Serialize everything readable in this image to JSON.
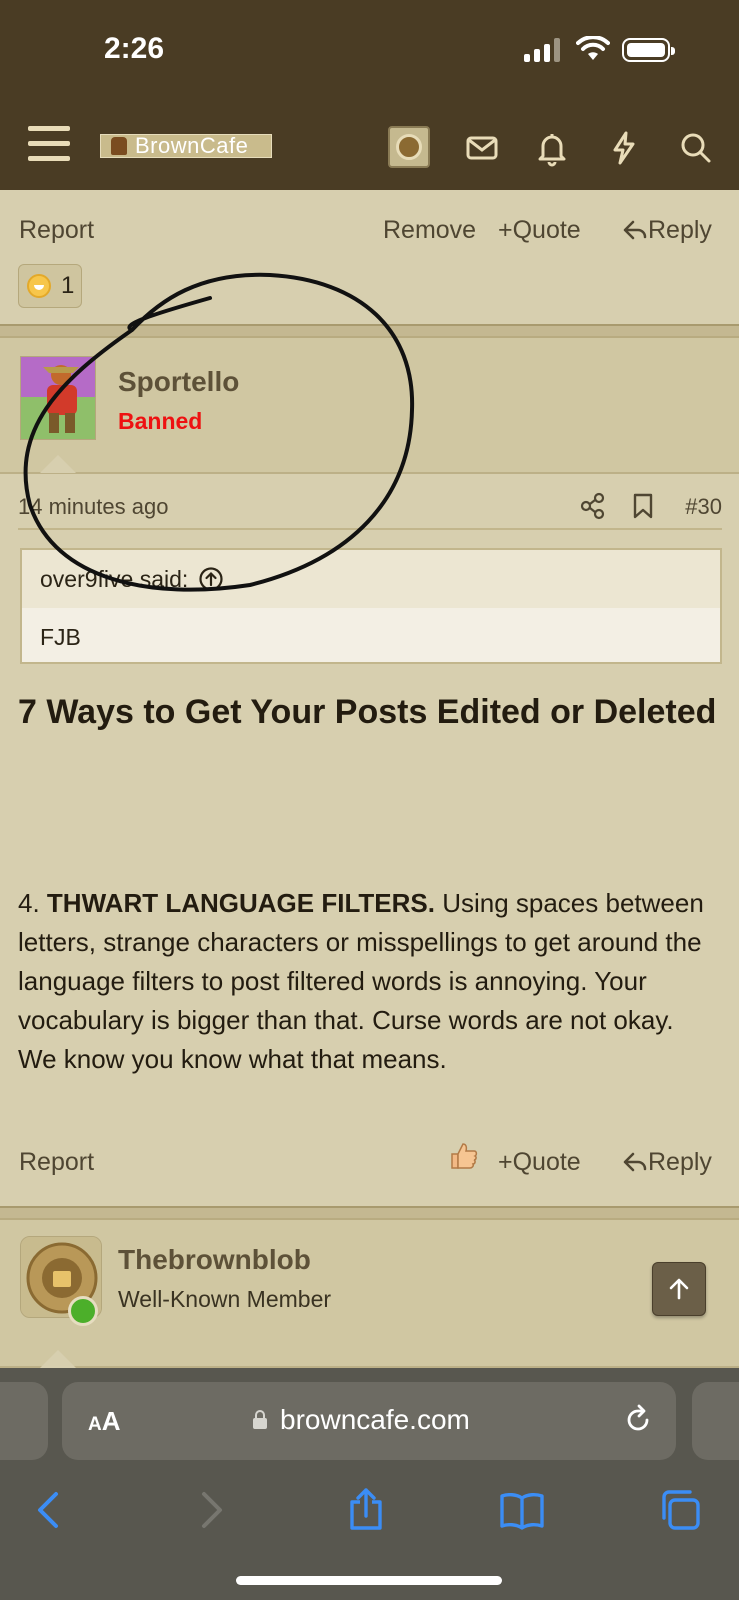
{
  "status": {
    "time": "2:26"
  },
  "header": {
    "site_name": "BrownCafe"
  },
  "first_post_actions": {
    "report": "Report",
    "remove": "Remove",
    "quote": "Quote",
    "reply": "Reply",
    "reaction_count": "1"
  },
  "post": {
    "author": "Sportello",
    "author_title": "Banned",
    "time": "14 minutes ago",
    "number": "#30",
    "quote_author": "over9five said:",
    "quote_text": "FJB",
    "heading": "7 Ways to Get Your Posts Edited or Deleted",
    "para_prefix": "4. ",
    "para_bold": "THWART LANGUAGE FILTERS.",
    "para_text": " Using spaces between letters, strange characters or misspellings to get around the language filters to post filtered words is annoying. Your vocabulary is bigger than that. Curse words are not okay. We know you know what that means.",
    "actions": {
      "report": "Report",
      "quote": "Quote",
      "reply": "Reply"
    }
  },
  "next_post": {
    "author": "Thebrownblob",
    "author_title": "Well-Known Member"
  },
  "browser": {
    "aa_big": "A",
    "aa_small": "A",
    "host": "browncafe.com"
  }
}
